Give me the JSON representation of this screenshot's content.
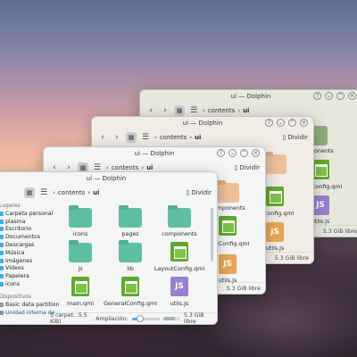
{
  "windows": {
    "back": {
      "title": "ui — Dolphin",
      "breadcrumb": [
        "contents",
        "ui"
      ],
      "items": [
        "components",
        "youtConfig.qml",
        "utils.js"
      ],
      "free": "5.3 GiB libre"
    },
    "middle": {
      "title": "ui — Dolphin",
      "breadcrumb": [
        "contents",
        "ui"
      ],
      "split": "Dividir",
      "items": [
        "components",
        "youtConfig.qml",
        "utils.js"
      ],
      "free": "5.3 GiB libre"
    },
    "third": {
      "title": "ui — Dolphin",
      "breadcrumb": [
        "contents",
        "ui"
      ],
      "split": "Dividir",
      "items": [
        "components",
        "youtConfig.qml",
        "utils.js"
      ],
      "free": "5.3 GiB libre"
    },
    "front": {
      "title": "ui — Dolphin",
      "breadcrumb": [
        "contents",
        "ui"
      ],
      "split": "Dividir",
      "sidebar": {
        "section_places": "Lugares",
        "places": [
          "Carpeta personal",
          "plasma",
          "Escritorio",
          "Documentos",
          "Descargas",
          "Música",
          "Imágenes",
          "Vídeos",
          "Papelera",
          "icons"
        ],
        "section_devices": "Dispositivos",
        "devices": [
          "Basic data partition",
          "Unidad interna de ..."
        ]
      },
      "files": [
        "icons",
        "pages",
        "components",
        "js",
        "lib",
        "LayoutConfig.qml",
        "main.qml",
        "GeneralConfig.qml",
        "utils.js"
      ],
      "js_badge": "JS",
      "status": "5 carpet...5.5 KiB)",
      "zoom_label": "Ampliación:",
      "zoom_level": 0.3,
      "free": "5.3 GiB libre",
      "space_used": 0.7
    }
  },
  "colors": {
    "folder_green": "#5fbfa5",
    "folder_orange": "#f0c09a",
    "accent": "#3daee9"
  },
  "icons": {
    "back": "chevron-left-icon",
    "forward": "chevron-right-icon",
    "view_icons": "grid-icon",
    "view_compact": "compact-icon",
    "split": "split-icon"
  }
}
